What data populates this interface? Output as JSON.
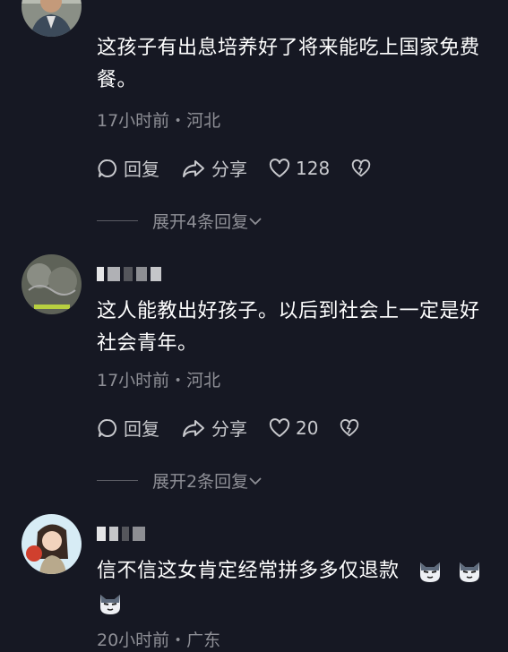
{
  "comments": [
    {
      "text": "这孩子有出息培养好了将来能吃上国家免费餐。",
      "meta": "17小时前・河北",
      "reply_label": "回复",
      "share_label": "分享",
      "likes": "128",
      "expand_label": "展开4条回复"
    },
    {
      "text": "这人能教出好孩子。以后到社会上一定是好社会青年。",
      "meta": "17小时前・河北",
      "reply_label": "回复",
      "share_label": "分享",
      "likes": "20",
      "expand_label": "展开2条回复"
    },
    {
      "text": "信不信这女肯定经常拼多多仅退款",
      "meta": "20小时前・广东"
    }
  ]
}
